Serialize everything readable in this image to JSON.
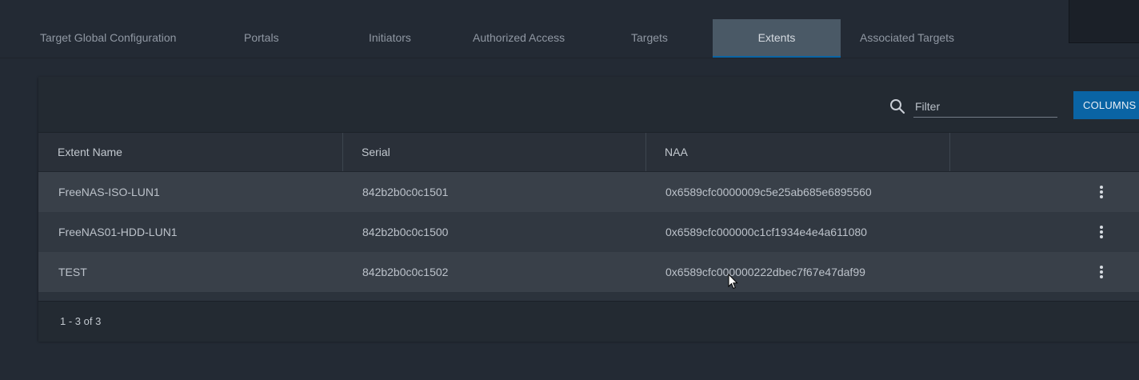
{
  "tabs": [
    {
      "label": "Target Global Configuration"
    },
    {
      "label": "Portals"
    },
    {
      "label": "Initiators"
    },
    {
      "label": "Authorized Access"
    },
    {
      "label": "Targets"
    },
    {
      "label": "Extents",
      "active": true
    },
    {
      "label": "Associated Targets"
    }
  ],
  "toolbar": {
    "filter_placeholder": "Filter",
    "columns_label": "COLUMNS"
  },
  "table": {
    "columns": [
      "Extent Name",
      "Serial",
      "NAA"
    ],
    "rows": [
      {
        "name": "FreeNAS-ISO-LUN1",
        "serial": "842b2b0c0c1501",
        "naa": "0x6589cfc0000009c5e25ab685e6895560"
      },
      {
        "name": "FreeNAS01-HDD-LUN1",
        "serial": "842b2b0c0c1500",
        "naa": "0x6589cfc000000c1cf1934e4e4a611080"
      },
      {
        "name": "TEST",
        "serial": "842b2b0c0c1502",
        "naa": "0x6589cfc000000222dbec7f67e47daf99"
      }
    ]
  },
  "footer": {
    "range": "1 - 3 of 3"
  },
  "colors": {
    "accent": "#0a64a4",
    "active_tab": "#4a5966"
  }
}
